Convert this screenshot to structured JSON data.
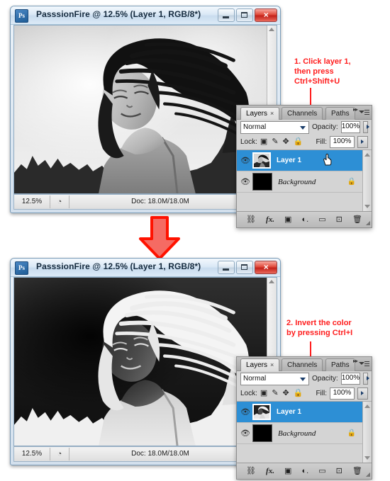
{
  "doc_window_1": {
    "title": "PasssionFire @ 12.5% (Layer 1, RGB/8*)",
    "app_icon_label": "Ps",
    "buttons": {
      "minimize": "minimize",
      "maximize": "maximize",
      "close": "×"
    },
    "status": {
      "zoom": "12.5%",
      "doc": "Doc: 18.0M/18.0M",
      "play": "▶",
      "scroll_left": "◂"
    }
  },
  "doc_window_2": {
    "title": "PasssionFire @ 12.5% (Layer 1, RGB/8*)",
    "app_icon_label": "Ps",
    "buttons": {
      "minimize": "minimize",
      "maximize": "maximize",
      "close": "×"
    },
    "status": {
      "zoom": "12.5%",
      "doc": "Doc: 18.0M/18.0M",
      "play": "▶",
      "scroll_left": "◂"
    }
  },
  "layers_panel_1": {
    "tabs": [
      {
        "label": "Layers",
        "close": "×",
        "active": true
      },
      {
        "label": "Channels",
        "active": false
      },
      {
        "label": "Paths",
        "active": false
      }
    ],
    "blend_mode": "Normal",
    "opacity_label": "Opacity:",
    "opacity_value": "100%",
    "lock_label": "Lock:",
    "lock_icons": [
      "lock-transparent-pixels",
      "lock-image-pixels",
      "lock-position",
      "lock-all"
    ],
    "fill_label": "Fill:",
    "fill_value": "100%",
    "layers": [
      {
        "name": "Layer 1",
        "selected": true,
        "visible": true,
        "locked": false,
        "thumb": "grayscale-portrait"
      },
      {
        "name": "Background",
        "selected": false,
        "visible": true,
        "locked": true,
        "thumb": "black"
      }
    ],
    "footer_icons": [
      "link-layers",
      "add-layer-style",
      "add-layer-mask",
      "new-adjustment-layer",
      "new-group",
      "new-layer",
      "delete-layer"
    ]
  },
  "layers_panel_2": {
    "tabs": [
      {
        "label": "Layers",
        "close": "×",
        "active": true
      },
      {
        "label": "Channels",
        "active": false
      },
      {
        "label": "Paths",
        "active": false
      }
    ],
    "blend_mode": "Normal",
    "opacity_label": "Opacity:",
    "opacity_value": "100%",
    "lock_label": "Lock:",
    "lock_icons": [
      "lock-transparent-pixels",
      "lock-image-pixels",
      "lock-position",
      "lock-all"
    ],
    "fill_label": "Fill:",
    "fill_value": "100%",
    "layers": [
      {
        "name": "Layer 1",
        "selected": true,
        "visible": true,
        "locked": false,
        "thumb": "inverted-portrait"
      },
      {
        "name": "Background",
        "selected": false,
        "visible": true,
        "locked": true,
        "thumb": "black"
      }
    ],
    "footer_icons": [
      "link-layers",
      "add-layer-style",
      "add-layer-mask",
      "new-adjustment-layer",
      "new-group",
      "new-layer",
      "delete-layer"
    ]
  },
  "annotations": {
    "step1": "1. Click layer 1,\nthen press\nCtrl+Shift+U",
    "step2": "2. Invert the color\nby pressing Ctrl+I"
  },
  "colors": {
    "annotation_red": "#ff1d1d",
    "selection_blue": "#2d8fd5",
    "titlebar_blue": "#dbe9f6",
    "panel_gray": "#d4d4d4",
    "close_button_red": "#e04b3c"
  },
  "flow_arrow": {
    "direction": "down",
    "color": "#ff2b24"
  }
}
